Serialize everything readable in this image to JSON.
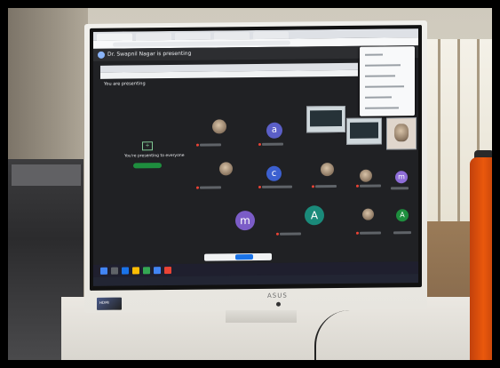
{
  "scene": {
    "description_type": "photo",
    "bottle_color": "#ea580c"
  },
  "meeting": {
    "presenter_banner": "Dr. Swapnil Nagar is presenting",
    "you_presenting": "You are presenting",
    "present_message": "You're presenting to everyone",
    "participants": [
      {
        "letter": "a",
        "color": "#5b5fc7"
      },
      {
        "letter": "c",
        "color": "#3c60d0"
      },
      {
        "letter": "m",
        "color": "#7b5cc7"
      },
      {
        "letter": "m",
        "color": "#8e6dd8"
      },
      {
        "letter": "A",
        "color": "#1a8a7a"
      },
      {
        "letter": "A",
        "color": "#1e8e3e"
      }
    ]
  },
  "monitor": {
    "brand": "ASUS",
    "sticker": "HDMI"
  }
}
